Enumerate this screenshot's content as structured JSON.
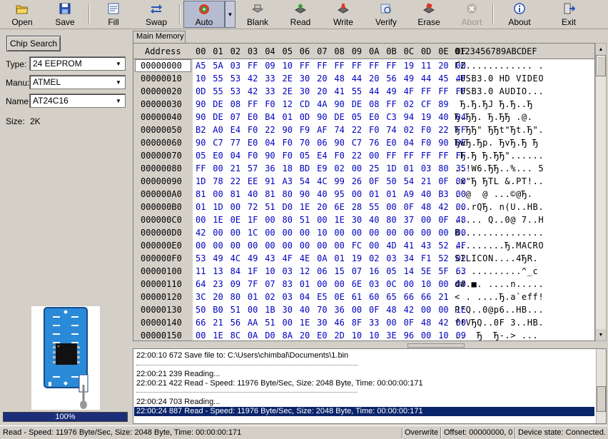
{
  "toolbar": {
    "buttons": [
      {
        "label": "Open",
        "icon": "open-folder-icon"
      },
      {
        "label": "Save",
        "icon": "floppy-disk-icon"
      },
      {
        "label": "Fill",
        "icon": "fill-icon"
      },
      {
        "label": "Swap",
        "icon": "swap-arrows-icon"
      },
      {
        "label": "Auto",
        "icon": "auto-program-icon"
      },
      {
        "label": "Blank",
        "icon": "blank-check-icon"
      },
      {
        "label": "Read",
        "icon": "read-chip-icon"
      },
      {
        "label": "Write",
        "icon": "write-chip-icon"
      },
      {
        "label": "Verify",
        "icon": "verify-icon"
      },
      {
        "label": "Erase",
        "icon": "erase-icon"
      },
      {
        "label": "Abort",
        "icon": "abort-icon"
      },
      {
        "label": "About",
        "icon": "info-icon"
      },
      {
        "label": "Exit",
        "icon": "exit-door-icon"
      }
    ]
  },
  "left_panel": {
    "chip_search_label": "Chip Search",
    "type_label": "Type:",
    "type_value": "24 EEPROM",
    "manu_label": "Manu:",
    "manu_value": "ATMEL",
    "name_label": "Name:",
    "name_value": "AT24C16",
    "size_label": "Size:",
    "size_value": "2K",
    "progress_label": "100%",
    "progress_fraction": 1.0
  },
  "memory": {
    "tab_label": "Main Memory",
    "address_header": "Address",
    "column_headers": [
      "00",
      "01",
      "02",
      "03",
      "04",
      "05",
      "06",
      "07",
      "08",
      "09",
      "0A",
      "0B",
      "0C",
      "0D",
      "0E",
      "0F"
    ],
    "ascii_header": "0123456789ABCDEF",
    "rows": [
      {
        "addr": "00000000",
        "bytes": [
          "A5",
          "5A",
          "03",
          "FF",
          "09",
          "10",
          "FF",
          "FF",
          "FF",
          "FF",
          "FF",
          "FF",
          "19",
          "11",
          "20",
          "00"
        ],
        "ascii": "ҐZ............ ."
      },
      {
        "addr": "00000010",
        "bytes": [
          "10",
          "55",
          "53",
          "42",
          "33",
          "2E",
          "30",
          "20",
          "48",
          "44",
          "20",
          "56",
          "49",
          "44",
          "45",
          "4F"
        ],
        "ascii": ".USB3.0 HD VIDEO"
      },
      {
        "addr": "00000020",
        "bytes": [
          "0D",
          "55",
          "53",
          "42",
          "33",
          "2E",
          "30",
          "20",
          "41",
          "55",
          "44",
          "49",
          "4F",
          "FF",
          "FF",
          "FF"
        ],
        "ascii": ".USB3.0 AUDIO..."
      },
      {
        "addr": "00000030",
        "bytes": [
          "90",
          "DE",
          "08",
          "FF",
          "F0",
          "12",
          "CD",
          "4A",
          "90",
          "DE",
          "08",
          "FF",
          "02",
          "CF",
          "89"
        ],
        "ascii": " Ђ.Ђ.ЂЈ Ђ.Ђ..Ђ"
      },
      {
        "addr": "00000040",
        "bytes": [
          "90",
          "DE",
          "07",
          "E0",
          "B4",
          "01",
          "0D",
          "90",
          "DE",
          "05",
          "E0",
          "C3",
          "94",
          "19",
          "40",
          "04"
        ],
        "ascii": "Ђ.ЂЂ. Ђ.ЂЂ .@."
      },
      {
        "addr": "00000050",
        "bytes": [
          "B2",
          "A0",
          "E4",
          "F0",
          "22",
          "90",
          "F9",
          "AF",
          "74",
          "22",
          "F0",
          "74",
          "02",
          "F0",
          "22",
          "FF"
        ],
        "ascii": "Ђ ЂЂ\" ЂЂt\"Ђt.Ђ\"."
      },
      {
        "addr": "00000060",
        "bytes": [
          "90",
          "C7",
          "77",
          "E0",
          "04",
          "F0",
          "70",
          "06",
          "90",
          "C7",
          "76",
          "E0",
          "04",
          "F0",
          "90",
          "DE"
        ],
        "ascii": "ЂwЂ.Ђp. ЂvЂ.Ђ Ђ"
      },
      {
        "addr": "00000070",
        "bytes": [
          "05",
          "E0",
          "04",
          "F0",
          "90",
          "F0",
          "05",
          "E4",
          "F0",
          "22",
          "00",
          "FF",
          "FF",
          "FF",
          "FF",
          "FF"
        ],
        "ascii": ".Ђ.Ђ Ђ.ЂЂ\"......"
      },
      {
        "addr": "00000080",
        "bytes": [
          "FF",
          "00",
          "21",
          "57",
          "36",
          "18",
          "BD",
          "E9",
          "02",
          "00",
          "25",
          "1D",
          "01",
          "03",
          "80",
          "35"
        ],
        "ascii": "..!W6.ЂЂ..%... 5"
      },
      {
        "addr": "00000090",
        "bytes": [
          "1D",
          "78",
          "22",
          "EE",
          "91",
          "A3",
          "54",
          "4C",
          "99",
          "26",
          "0F",
          "50",
          "54",
          "21",
          "0F",
          "00"
        ],
        "ascii": ".x\"Ђ ЂTL &.PT!.."
      },
      {
        "addr": "000000A0",
        "bytes": [
          "81",
          "00",
          "81",
          "40",
          "81",
          "80",
          "90",
          "40",
          "95",
          "00",
          "01",
          "01",
          "A9",
          "40",
          "B3",
          "00"
        ],
        "ascii": ". @  @ ...©@Ђ."
      },
      {
        "addr": "000000B0",
        "bytes": [
          "01",
          "1D",
          "00",
          "72",
          "51",
          "D0",
          "1E",
          "20",
          "6E",
          "28",
          "55",
          "00",
          "0F",
          "48",
          "42",
          "00"
        ],
        "ascii": "...rQЂ. n(U..HB."
      },
      {
        "addr": "000000C0",
        "bytes": [
          "00",
          "1E",
          "0E",
          "1F",
          "00",
          "80",
          "51",
          "00",
          "1E",
          "30",
          "40",
          "80",
          "37",
          "00",
          "0F",
          "48"
        ],
        "ascii": "..... Q..0@ 7..H"
      },
      {
        "addr": "000000D0",
        "bytes": [
          "42",
          "00",
          "00",
          "1C",
          "00",
          "00",
          "00",
          "10",
          "00",
          "00",
          "00",
          "00",
          "00",
          "00",
          "00",
          "00"
        ],
        "ascii": "B..............."
      },
      {
        "addr": "000000E0",
        "bytes": [
          "00",
          "00",
          "00",
          "00",
          "00",
          "00",
          "00",
          "00",
          "00",
          "FC",
          "00",
          "4D",
          "41",
          "43",
          "52",
          "4F"
        ],
        "ascii": ".........Ђ.MACRO"
      },
      {
        "addr": "000000F0",
        "bytes": [
          "53",
          "49",
          "4C",
          "49",
          "43",
          "4F",
          "4E",
          "0A",
          "01",
          "19",
          "02",
          "03",
          "34",
          "F1",
          "52",
          "02"
        ],
        "ascii": "SILICON....4ЂR."
      },
      {
        "addr": "00000100",
        "bytes": [
          "11",
          "13",
          "84",
          "1F",
          "10",
          "03",
          "12",
          "06",
          "15",
          "07",
          "16",
          "05",
          "14",
          "5E",
          "5F",
          "63"
        ],
        "ascii": ".. .........^_c"
      },
      {
        "addr": "00000110",
        "bytes": [
          "64",
          "23",
          "09",
          "7F",
          "07",
          "83",
          "01",
          "00",
          "00",
          "6E",
          "03",
          "0C",
          "00",
          "10",
          "00",
          "00"
        ],
        "ascii": "d#.■. ....n....."
      },
      {
        "addr": "00000120",
        "bytes": [
          "3C",
          "20",
          "80",
          "01",
          "02",
          "03",
          "04",
          "E5",
          "0E",
          "61",
          "60",
          "65",
          "66",
          "66",
          "21"
        ],
        "ascii": "< . ....Ђ.a`eff!"
      },
      {
        "addr": "00000130",
        "bytes": [
          "50",
          "B0",
          "51",
          "00",
          "1B",
          "30",
          "40",
          "70",
          "36",
          "00",
          "0F",
          "48",
          "42",
          "00",
          "00",
          "1E"
        ],
        "ascii": "P°Q..0@p6..HB..."
      },
      {
        "addr": "00000140",
        "bytes": [
          "66",
          "21",
          "56",
          "AA",
          "51",
          "00",
          "1E",
          "30",
          "46",
          "8F",
          "33",
          "00",
          "0F",
          "48",
          "42",
          "00"
        ],
        "ascii": "f!VЂQ..0F 3..HB."
      },
      {
        "addr": "00000150",
        "bytes": [
          "00",
          "1E",
          "8C",
          "0A",
          "D0",
          "8A",
          "20",
          "E0",
          "2D",
          "10",
          "10",
          "3E",
          "96",
          "00",
          "10",
          "09"
        ],
        "ascii": "..  Ђ  Ђ-.> ..."
      }
    ]
  },
  "log": {
    "lines": [
      "22:00:10 672 Save file to: C:\\Users\\chimbal\\Documents\\1.bin",
      "22:00:21 239 Reading...",
      "22:00:21 422 Read - Speed: 11976 Byte/Sec, Size: 2048 Byte, Time: 00:00:00:171",
      "22:00:24 703 Reading...",
      "22:00:24 887 Read - Speed: 11976 Byte/Sec, Size: 2048 Byte, Time: 00:00:00:171"
    ]
  },
  "status": {
    "message": "Read - Speed: 11976 Byte/Sec, Size: 2048 Byte, Time: 00:00:00:171",
    "mode": "Overwrite",
    "offset": "Offset: 00000000, 0",
    "device": "Device state: Connected."
  }
}
